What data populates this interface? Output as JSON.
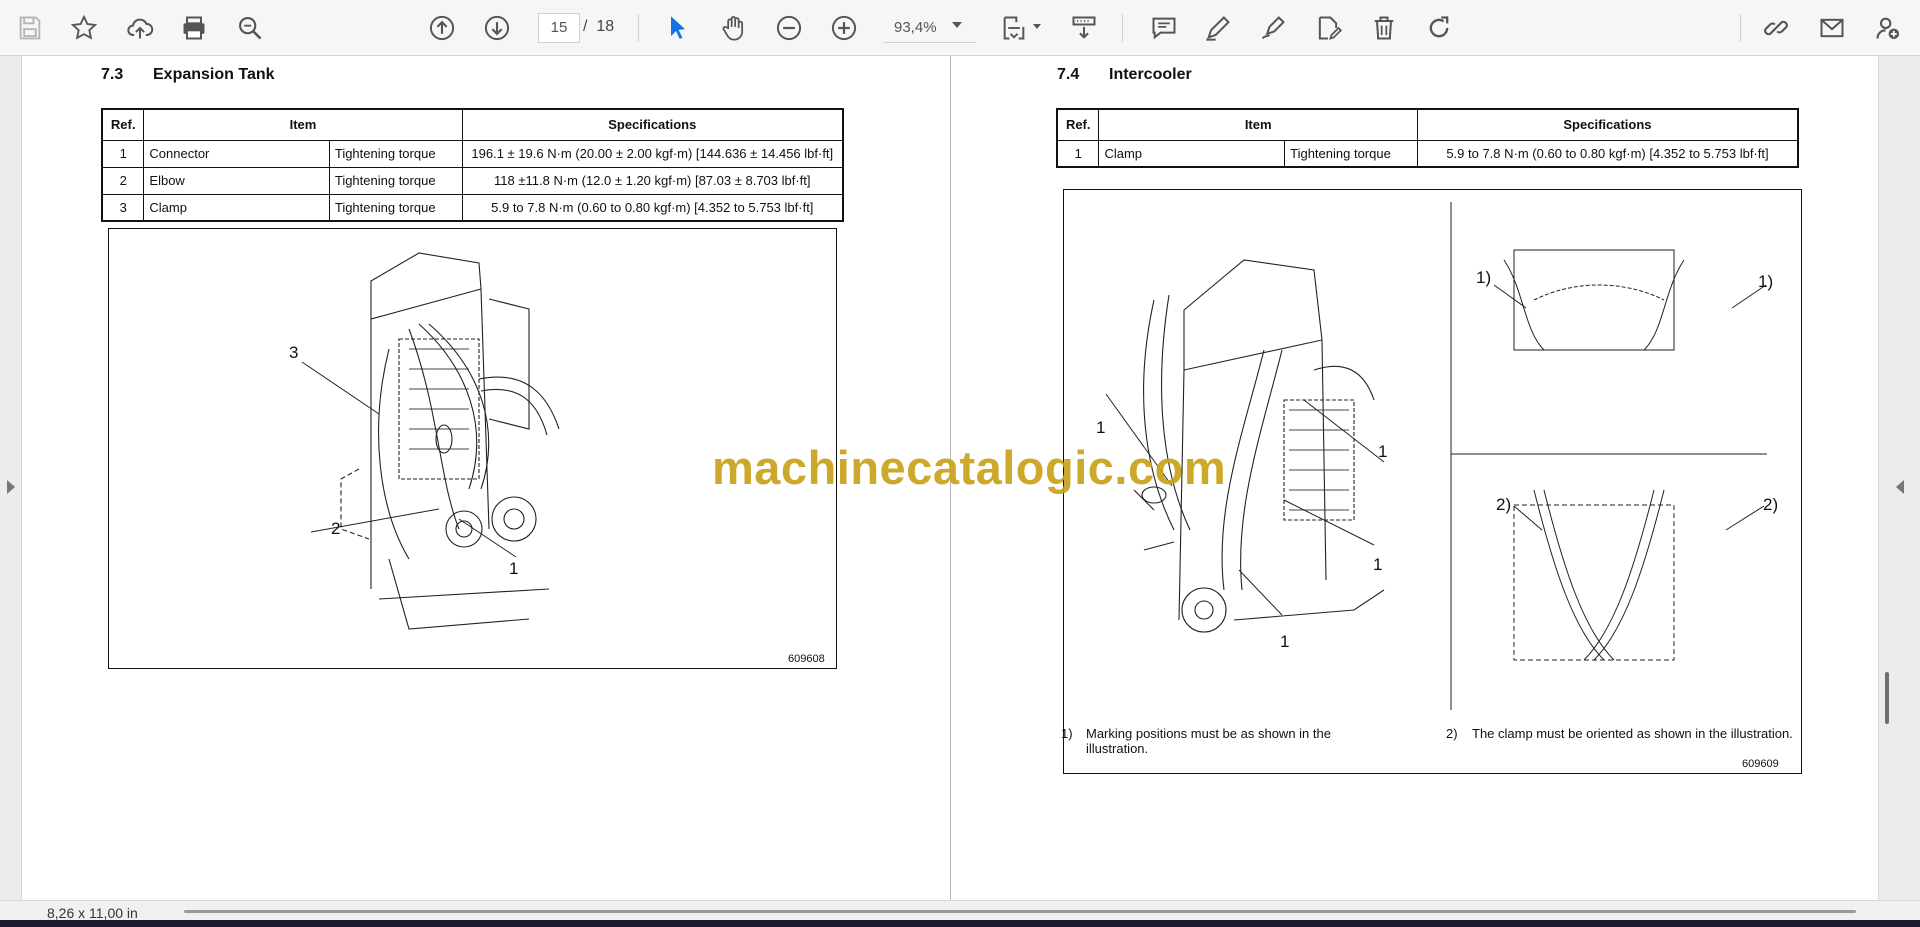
{
  "toolbar": {
    "icons": [
      "save-icon",
      "bookmark-star-icon",
      "upload-cloud-icon",
      "print-icon",
      "zoom-search-icon",
      "page-up-icon",
      "page-down-icon",
      "select-cursor-icon",
      "hand-tool-icon",
      "zoom-out-icon",
      "zoom-in-icon",
      "page-fit-icon",
      "scan-icon",
      "comment-icon",
      "highlight-pen-icon",
      "sign-pen-icon",
      "edit-document-icon",
      "delete-icon",
      "rotate-icon",
      "share-link-icon",
      "email-icon",
      "add-user-icon"
    ],
    "current_page": "15",
    "page_separator": "/",
    "total_pages": "18",
    "zoom": "93,4%"
  },
  "left_page": {
    "section_number": "7.3",
    "section_title": "Expansion Tank",
    "table": {
      "headers": [
        "Ref.",
        "Item",
        "Specifications"
      ],
      "rows": [
        {
          "ref": "1",
          "item": "Connector",
          "type": "Tightening torque",
          "spec": "196.1 ± 19.6 N·m (20.00 ± 2.00  kgf·m) [144.636 ± 14.456 lbf·ft]"
        },
        {
          "ref": "2",
          "item": "Elbow",
          "type": "Tightening torque",
          "spec": "118 ±11.8 N·m (12.0 ± 1.20 kgf·m) [87.03 ± 8.703 lbf·ft]"
        },
        {
          "ref": "3",
          "item": "Clamp",
          "type": "Tightening torque",
          "spec": "5.9 to 7.8 N·m (0.60 to 0.80 kgf·m) [4.352 to 5.753 lbf·ft]"
        }
      ]
    },
    "figure": {
      "callouts": [
        "3",
        "2",
        "1"
      ],
      "figure_id": "609608"
    }
  },
  "right_page": {
    "section_number": "7.4",
    "section_title": "Intercooler",
    "table": {
      "headers": [
        "Ref.",
        "Item",
        "Specifications"
      ],
      "rows": [
        {
          "ref": "1",
          "item": "Clamp",
          "type": "Tightening torque",
          "spec": "5.9 to 7.8 N·m (0.60 to 0.80 kgf·m) [4.352 to 5.753 lbf·ft]"
        }
      ]
    },
    "figure": {
      "callouts_main": [
        "1",
        "1",
        "1",
        "1"
      ],
      "callouts_top": [
        "1)",
        "1)"
      ],
      "callouts_bottom": [
        "2)",
        "2)"
      ],
      "figure_id": "609609"
    },
    "notes": [
      {
        "num": "1)",
        "text": "Marking positions must be as shown in the illustration."
      },
      {
        "num": "2)",
        "text": "The clamp must be oriented as shown in the illustration."
      }
    ]
  },
  "watermark": "machinecatalogic.com",
  "status": {
    "page_size": "8,26 x 11,00 in"
  },
  "colors": {
    "watermark": "#c9a21a",
    "select_tool_active": "#1473e6",
    "toolbar_bg": "#f6f6f6"
  }
}
